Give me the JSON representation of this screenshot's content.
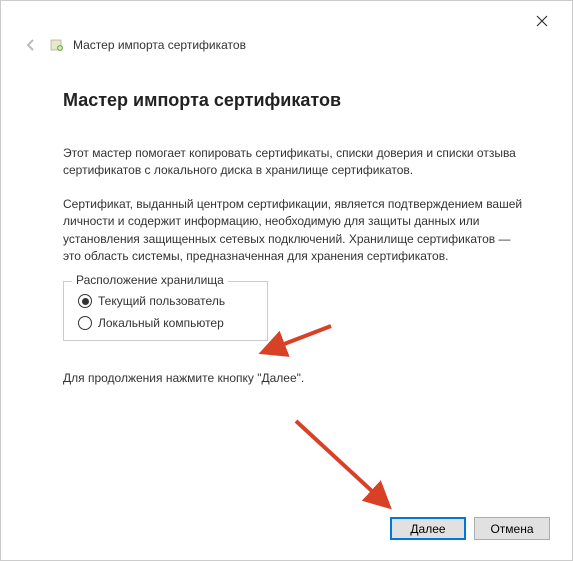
{
  "header": {
    "title": "Мастер импорта сертификатов"
  },
  "main": {
    "heading": "Мастер импорта сертификатов",
    "paragraph1": "Этот мастер помогает копировать сертификаты, списки доверия и списки отзыва сертификатов с локального диска в хранилище сертификатов.",
    "paragraph2": "Сертификат, выданный центром сертификации, является подтверждением вашей личности и содержит информацию, необходимую для защиты данных или установления защищенных сетевых подключений. Хранилище сертификатов — это область системы, предназначенная для хранения сертификатов.",
    "fieldset_legend": "Расположение хранилища",
    "radio_current_user": "Текущий пользователь",
    "radio_local_computer": "Локальный компьютер",
    "continue_text": "Для продолжения нажмите кнопку \"Далее\"."
  },
  "footer": {
    "next_label": "Далее",
    "cancel_label": "Отмена"
  },
  "annotations": {
    "arrow_color": "#d94126"
  }
}
